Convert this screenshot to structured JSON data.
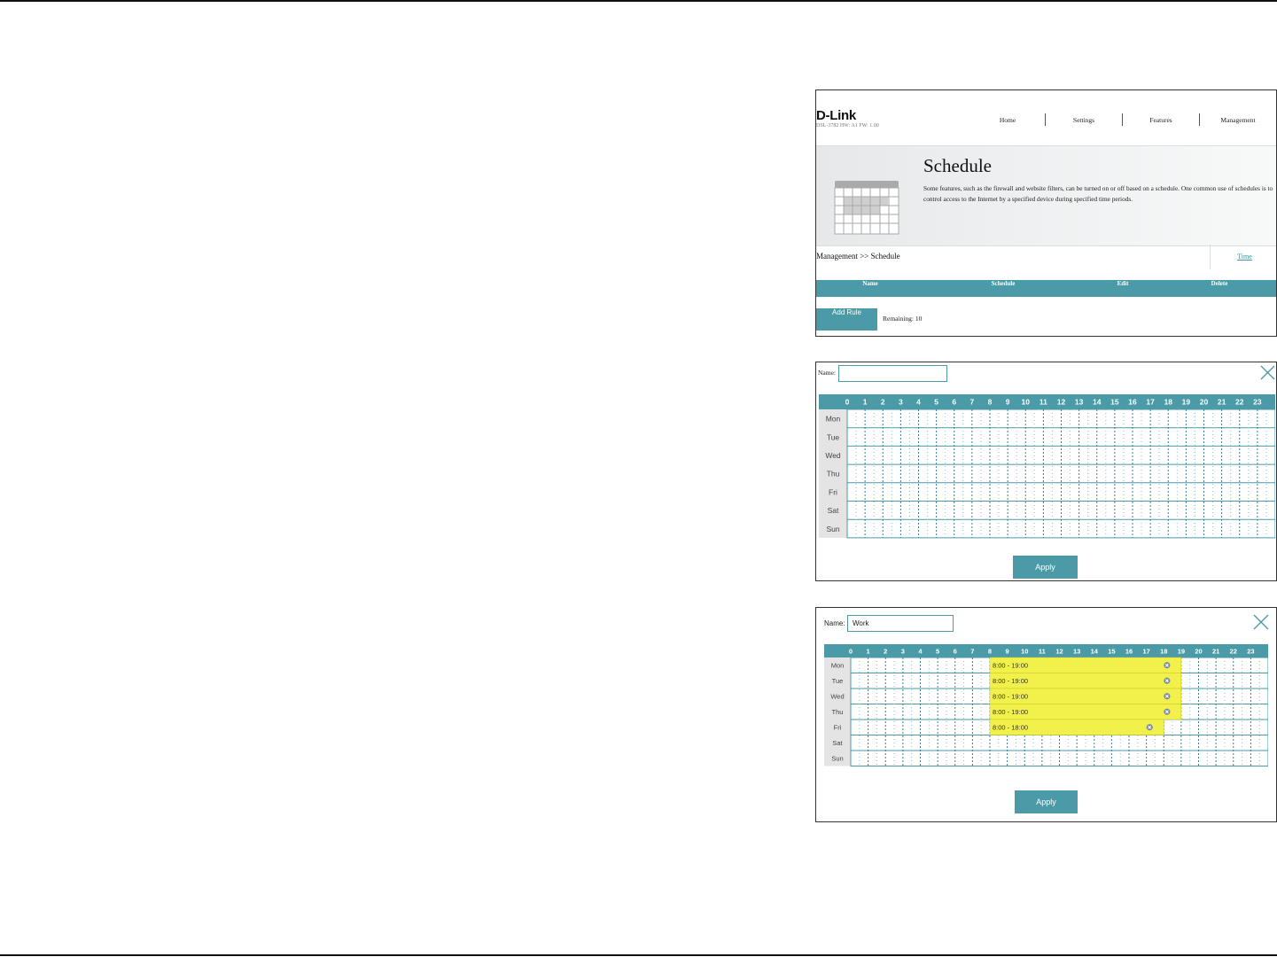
{
  "panel1": {
    "logo": "D-Link",
    "model": "DSL-3782  HW: A1  FW: 1.00",
    "nav": [
      "Home",
      "Settings",
      "Features",
      "Management"
    ],
    "title": "Schedule",
    "description": "Some features, such as the firewall and website filters, can be turned on or off based on a schedule. One common use of schedules is to control access to the Internet by a specified device during specified time periods.",
    "breadcrumb": "Management >> Schedule",
    "time_link": "Time",
    "columns": [
      "Name",
      "Schedule",
      "Edit",
      "Delete"
    ],
    "add_rule": "Add Rule",
    "remaining": "Remaining: 10",
    "icon": "calendar-icon"
  },
  "panel2": {
    "name_label": "Name:",
    "name_value": "",
    "hours": [
      "0",
      "1",
      "2",
      "3",
      "4",
      "5",
      "6",
      "7",
      "8",
      "9",
      "10",
      "11",
      "12",
      "13",
      "14",
      "15",
      "16",
      "17",
      "18",
      "19",
      "20",
      "21",
      "22",
      "23"
    ],
    "days": [
      "Mon",
      "Tue",
      "Wed",
      "Thu",
      "Fri",
      "Sat",
      "Sun"
    ],
    "apply": "Apply",
    "close_icon": "close-icon"
  },
  "panel3": {
    "name_label": "Name:",
    "name_value": "Work",
    "hours": [
      "0",
      "1",
      "2",
      "3",
      "4",
      "5",
      "6",
      "7",
      "8",
      "9",
      "10",
      "11",
      "12",
      "13",
      "14",
      "15",
      "16",
      "17",
      "18",
      "19",
      "20",
      "21",
      "22",
      "23"
    ],
    "days": [
      "Mon",
      "Tue",
      "Wed",
      "Thu",
      "Fri",
      "Sat",
      "Sun"
    ],
    "blocks": [
      {
        "day": 0,
        "start": 8,
        "end": 19,
        "label": "8:00 - 19:00"
      },
      {
        "day": 1,
        "start": 8,
        "end": 19,
        "label": "8:00 - 19:00"
      },
      {
        "day": 2,
        "start": 8,
        "end": 19,
        "label": "8:00 - 19:00"
      },
      {
        "day": 3,
        "start": 8,
        "end": 19,
        "label": "8:00 - 19:00"
      },
      {
        "day": 4,
        "start": 8,
        "end": 18,
        "label": "8:00 - 18:00"
      }
    ],
    "apply": "Apply",
    "close_icon": "close-icon",
    "remove_icon": "remove-icon"
  },
  "colors": {
    "accent": "#4a9aa8",
    "highlight": "#f2f04a"
  }
}
